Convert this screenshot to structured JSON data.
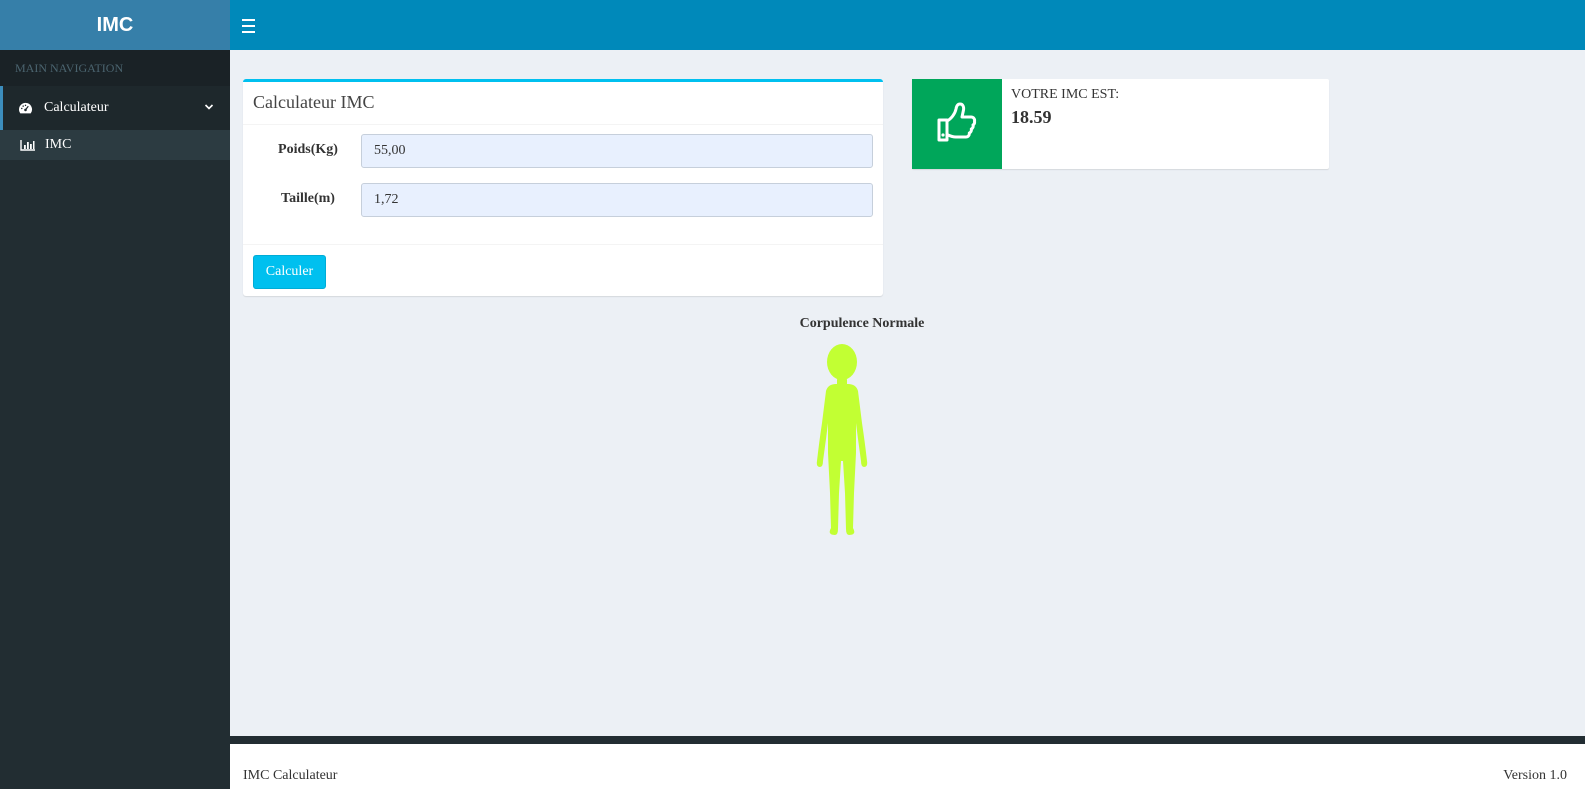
{
  "app": {
    "logo": "IMC"
  },
  "sidebar": {
    "header": "MAIN NAVIGATION",
    "items": [
      {
        "label": "Calculateur",
        "icon": "dashboard-icon",
        "expanded": true,
        "children": [
          {
            "label": "IMC",
            "icon": "bar-chart-icon"
          }
        ]
      }
    ]
  },
  "form": {
    "title": "Calculateur IMC",
    "weight_label": "Poids(Kg)",
    "weight_value": "55,00",
    "height_label": "Taille(m)",
    "height_value": "1,72",
    "submit_label": "Calculer"
  },
  "result": {
    "label": "VOTRE IMC EST:",
    "value": "18.59",
    "icon": "thumbs-up-icon",
    "accent": "#00a65a"
  },
  "corpulence": {
    "label": "Corpulence Normale",
    "figure_color": "#c2ff33"
  },
  "footer": {
    "left": "IMC Calculateur",
    "right": "Version 1.0"
  }
}
